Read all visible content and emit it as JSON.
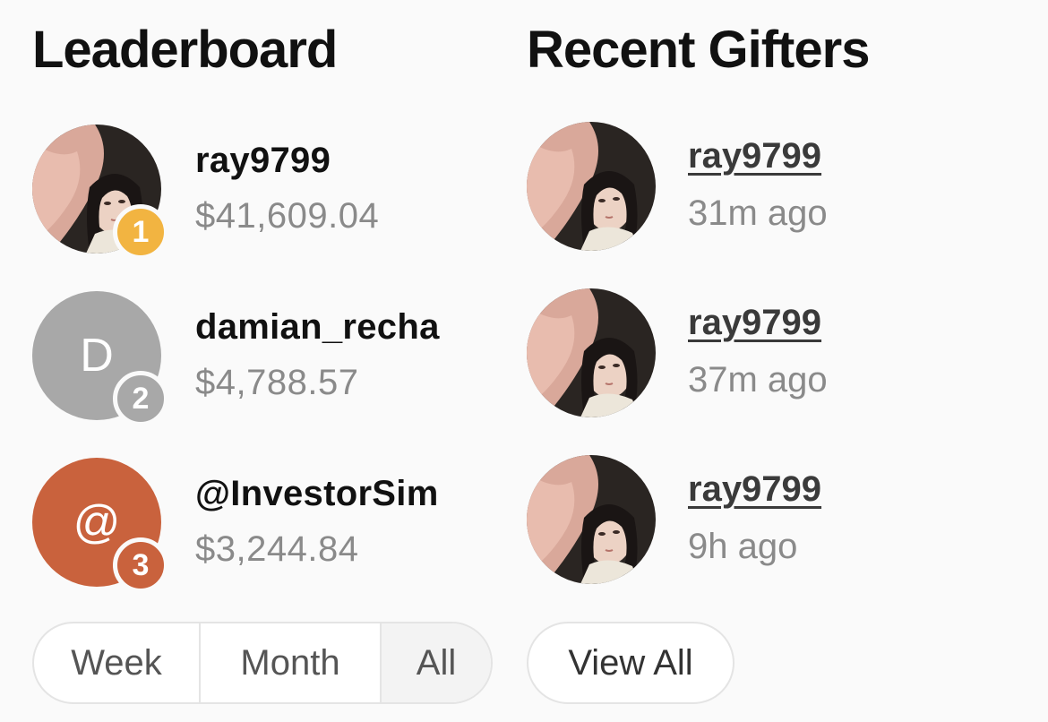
{
  "leaderboard": {
    "title": "Leaderboard",
    "entries": [
      {
        "rank": "1",
        "name": "ray9799",
        "amount": "$41,609.04",
        "avatar": "photo",
        "rank_color": "#f2b441"
      },
      {
        "rank": "2",
        "name": "damian_recha",
        "amount": "$4,788.57",
        "avatar_initial": "D",
        "avatar_color": "#a8a8a8",
        "rank_color": "#a8a8a8"
      },
      {
        "rank": "3",
        "name": "@InvestorSim",
        "amount": "$3,244.84",
        "avatar_initial": "@",
        "avatar_color": "#c9623d",
        "rank_color": "#c9623d"
      }
    ],
    "filters": [
      "Week",
      "Month",
      "All"
    ],
    "active_filter": "All"
  },
  "recent_gifters": {
    "title": "Recent Gifters",
    "entries": [
      {
        "name": "ray9799",
        "time": "31m ago"
      },
      {
        "name": "ray9799",
        "time": "37m ago"
      },
      {
        "name": "ray9799",
        "time": "9h ago"
      }
    ],
    "view_all_label": "View All"
  },
  "colors": {
    "background": "#fafafa",
    "gold": "#f2b441",
    "silver": "#a8a8a8",
    "bronze": "#c9623d",
    "muted_text": "#8a8a8a"
  }
}
